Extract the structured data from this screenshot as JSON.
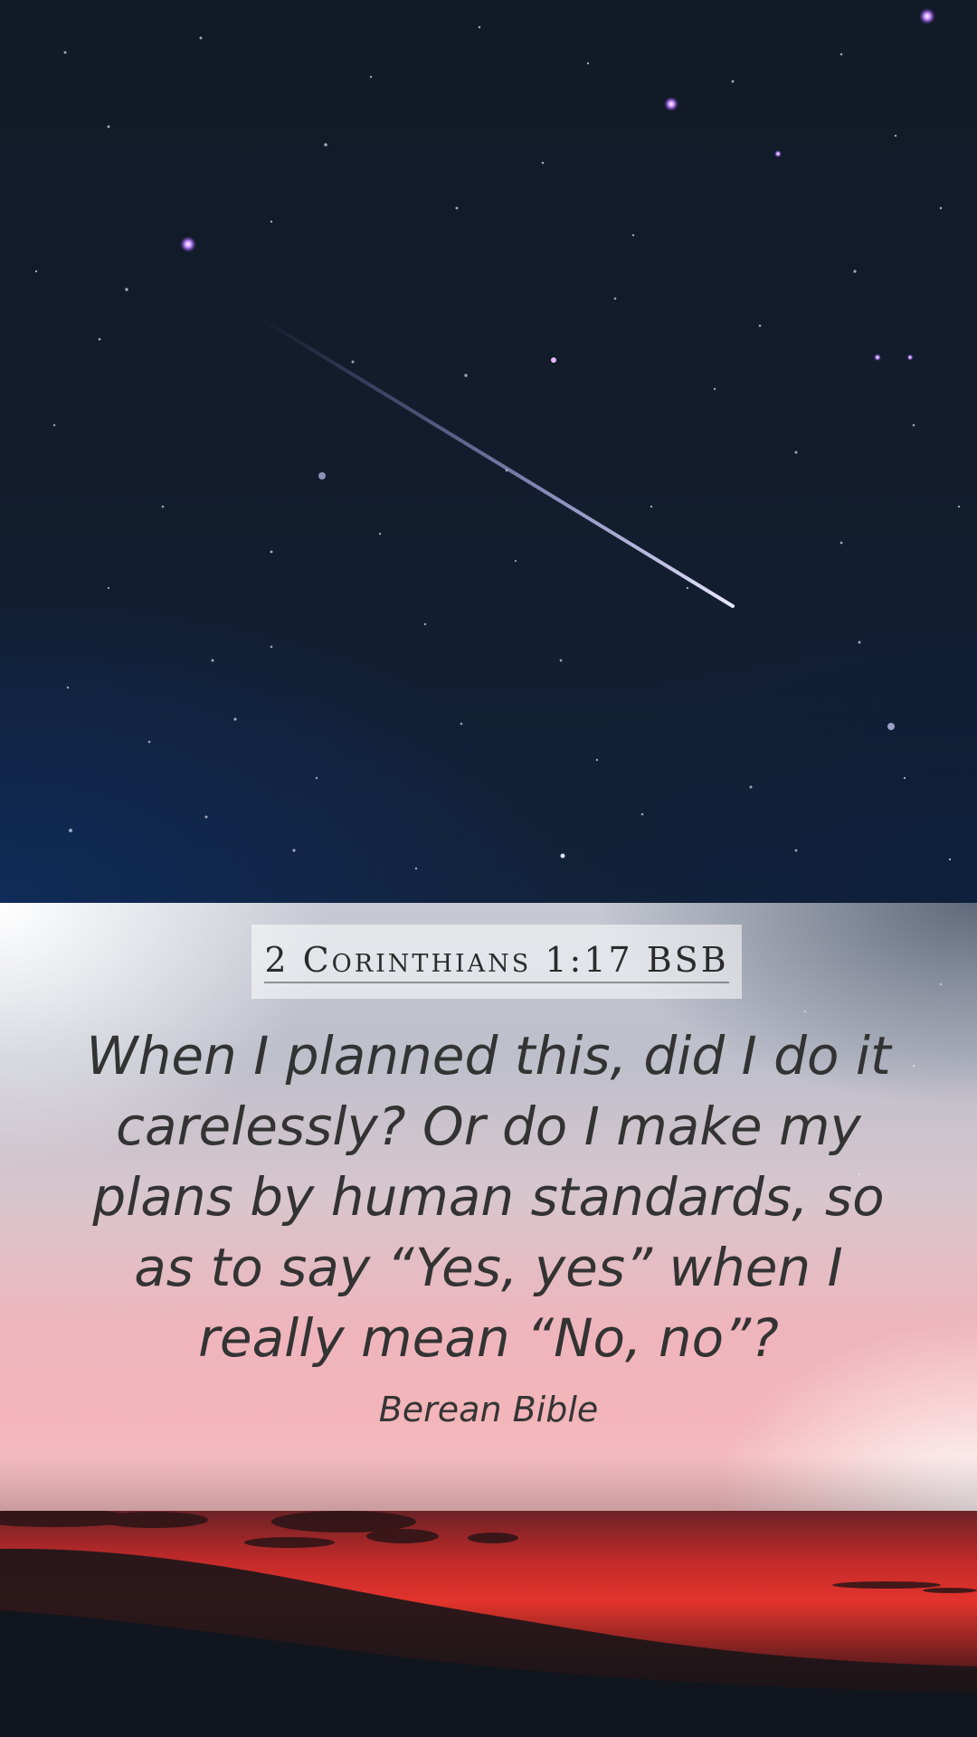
{
  "reference": "2 Corinthians 1:17 BSB",
  "verse_text": "When I planned this, did I do it carelessly? Or do I make my plans by human standards, so as to say “Yes, yes” when I really mean “No, no”?",
  "translation": "Berean Bible",
  "colors": {
    "sky": "#121c2c",
    "text": "#333333",
    "sunset_red": "#e2342c"
  }
}
